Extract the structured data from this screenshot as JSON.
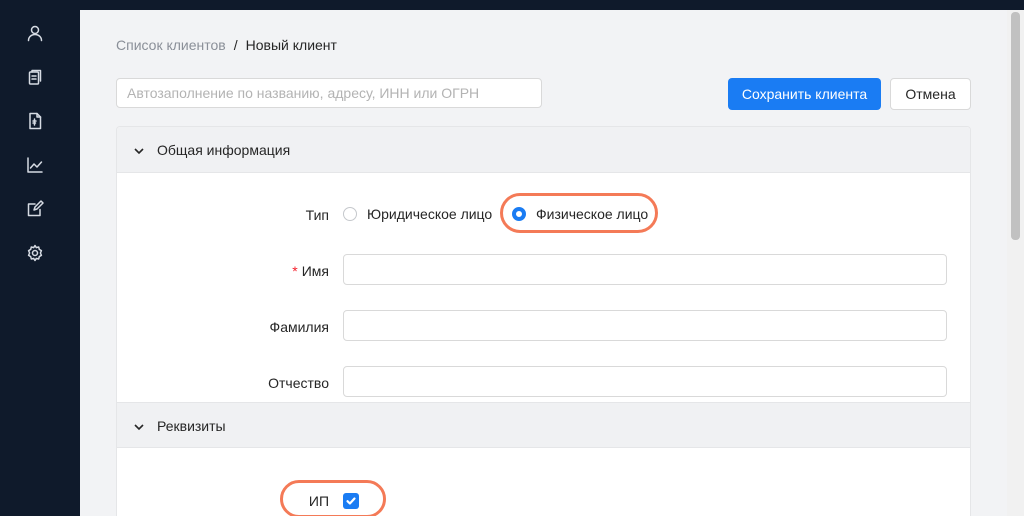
{
  "sidebar": {
    "items": [
      {
        "icon": "user-icon"
      },
      {
        "icon": "clipboard-icon"
      },
      {
        "icon": "document-currency-icon"
      },
      {
        "icon": "chart-icon"
      },
      {
        "icon": "edit-icon"
      },
      {
        "icon": "gear-icon"
      }
    ]
  },
  "breadcrumb": {
    "parent": "Список клиентов",
    "separator": "/",
    "current": "Новый клиент"
  },
  "toolbar": {
    "autofill_placeholder": "Автозаполнение по названию, адресу, ИНН или ОГРН",
    "save_label": "Сохранить клиента",
    "cancel_label": "Отмена"
  },
  "general_info": {
    "title": "Общая информация",
    "type_label": "Тип",
    "type_options": [
      {
        "label": "Юридическое лицо",
        "selected": false
      },
      {
        "label": "Физическое лицо",
        "selected": true
      }
    ],
    "first_name_label": "Имя",
    "first_name_required": "*",
    "first_name_value": "",
    "last_name_label": "Фамилия",
    "last_name_value": "",
    "patronymic_label": "Отчество",
    "patronymic_value": ""
  },
  "requisites": {
    "title": "Реквизиты",
    "ip_label": "ИП",
    "ip_checked": true
  },
  "colors": {
    "accent": "#1a7cf3",
    "highlight": "#f47a57",
    "sidebar_bg": "#0f1a2b"
  }
}
